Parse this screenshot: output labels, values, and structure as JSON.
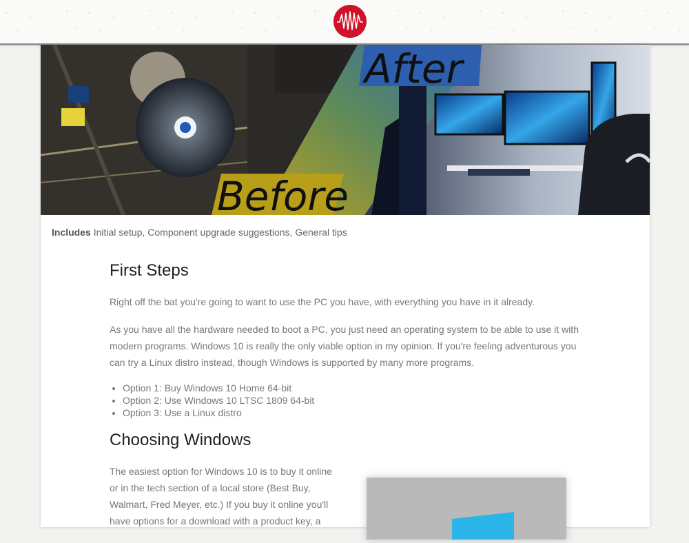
{
  "header": {
    "logo_icon": "red-waveform-logo-icon",
    "accent": "#d0112b"
  },
  "hero": {
    "before_label": "Before",
    "after_label": "After"
  },
  "includes": {
    "label": "Includes",
    "text": "Initial setup, Component upgrade suggestions, General tips"
  },
  "first_steps": {
    "heading": "First Steps",
    "para1": "Right off the bat you're going to want to use the PC you have, with everything you have in it already.",
    "para2_lines": [
      "As you have all the hardware needed to boot a PC, you just need an operating system to be able to use it with",
      "modern programs. Windows 10 is really the only viable option in my opinion. If you're feeling adventurous you",
      "can try a Linux distro instead, though Windows is supported by many more programs."
    ],
    "options": [
      "Option 1: Buy Windows 10 Home 64-bit",
      "Option 2: Use Windows 10 LTSC 1809 64-bit",
      "Option 3: Use a Linux distro"
    ]
  },
  "choosing_windows": {
    "heading": "Choosing Windows",
    "para_lines": [
      "The easiest option for Windows 10 is to buy it online",
      "or in the tech section of a local store (Best Buy,",
      "Walmart, Fred Meyer, etc.) If you buy it online you'll",
      "have options for a download with a product key, a"
    ]
  }
}
